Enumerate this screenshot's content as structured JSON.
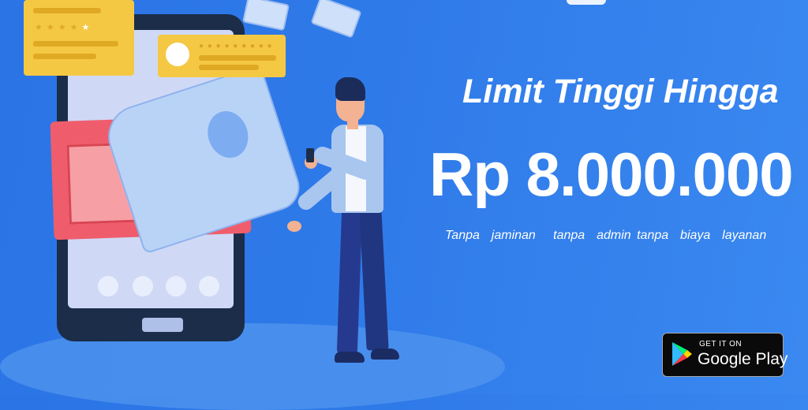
{
  "headline": "Limit Tinggi Hingga",
  "amount": "Rp 8.000.000",
  "tagline": "Tanpa  jaminan   tanpa  admin tanpa  biaya  layanan",
  "store_badge": {
    "top_text": "GET IT ON",
    "main_text": "Google Play",
    "icon": "google-play-icon"
  },
  "colors": {
    "background": "#2f7ae9",
    "text": "#ffffff",
    "card": "#f5c844",
    "wallet": "#ef5d6d"
  },
  "illustration": {
    "rating_stars": 5,
    "filled_stars": 4
  }
}
